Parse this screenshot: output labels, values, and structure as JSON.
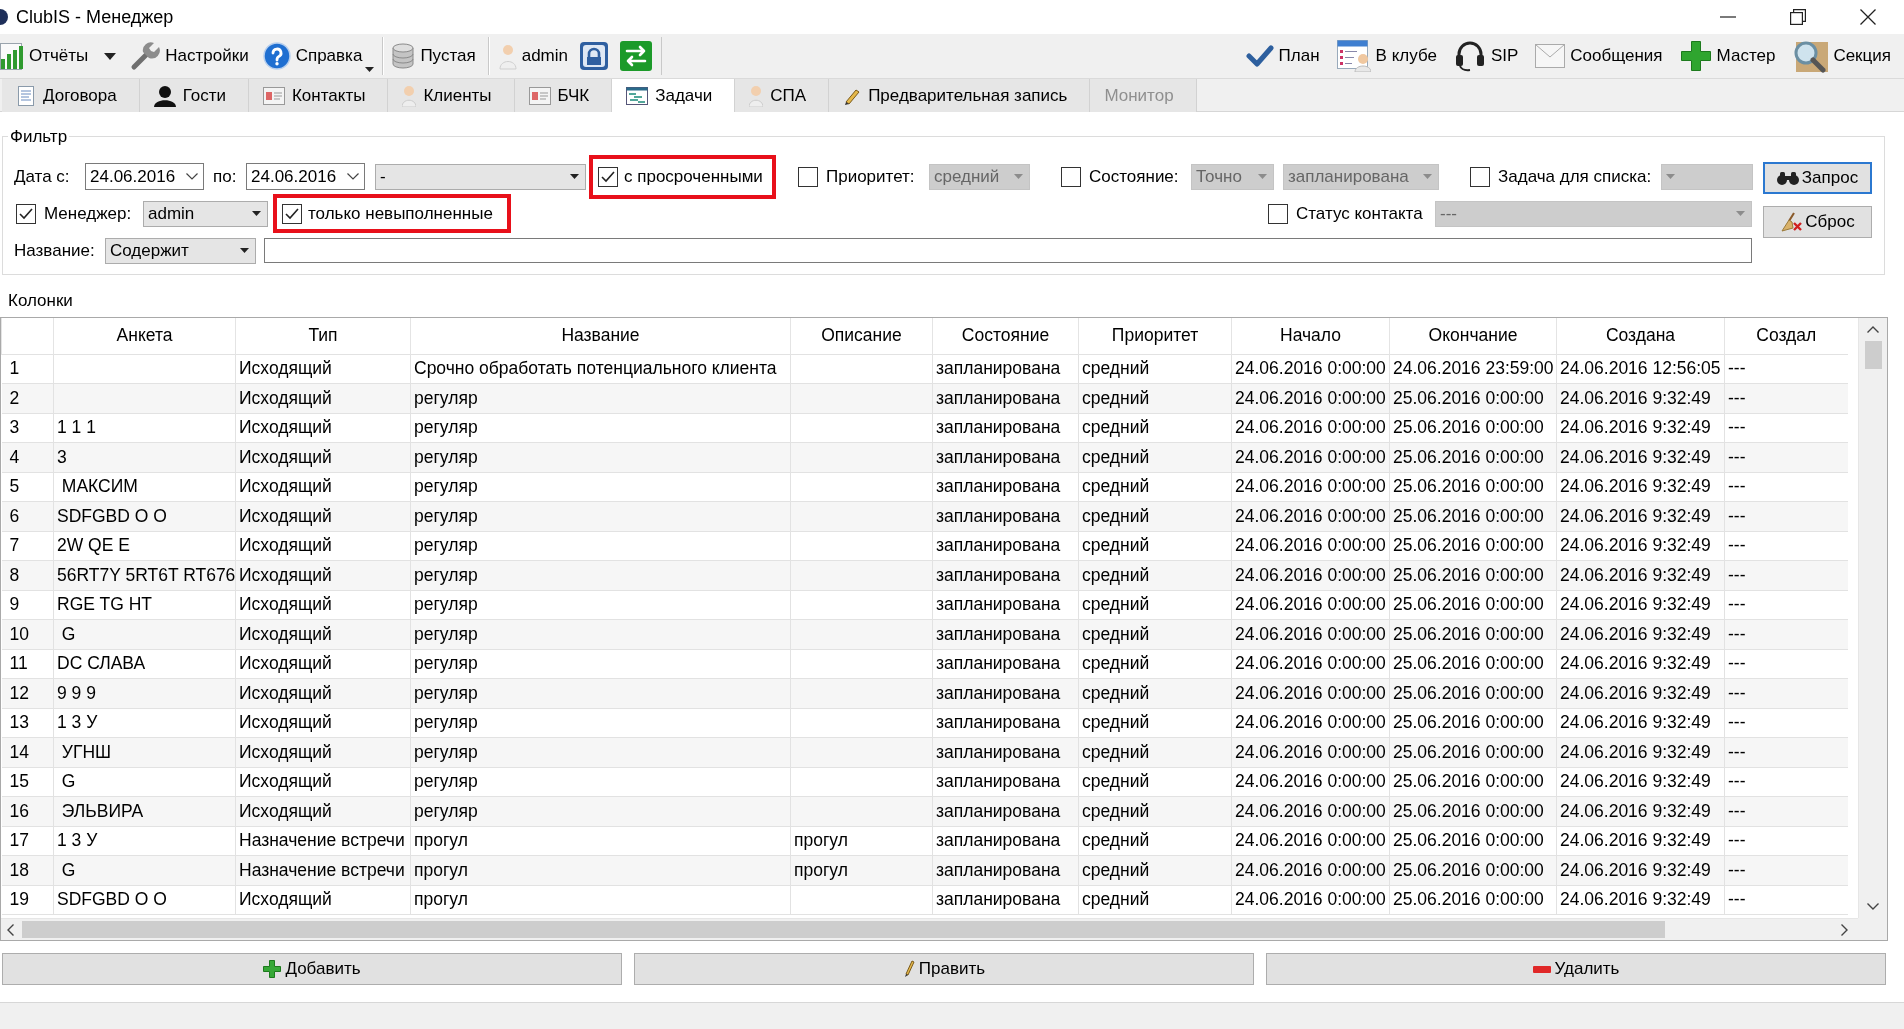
{
  "window": {
    "title": "ClubIS - Менеджер"
  },
  "toolbar": {
    "groups": [
      [
        {
          "kind": "split",
          "label": "Отчёты"
        },
        {
          "kind": "button",
          "label": "Настройки"
        },
        {
          "kind": "menu",
          "label": "Справка"
        }
      ],
      [
        {
          "kind": "button",
          "label": "Пустая"
        }
      ],
      [
        {
          "kind": "button",
          "label": "admin"
        },
        {
          "kind": "icon"
        },
        {
          "kind": "icon"
        }
      ]
    ],
    "right": [
      {
        "kind": "button",
        "label": "План"
      },
      {
        "kind": "button",
        "label": "В клубе"
      },
      {
        "kind": "button",
        "label": "SIP"
      },
      {
        "kind": "button",
        "label": "Сообщения"
      },
      {
        "kind": "button",
        "label": "Мастер"
      },
      {
        "kind": "button",
        "label": "Секция"
      }
    ]
  },
  "tabs": [
    {
      "label": "Договора",
      "selected": false,
      "disabled": false
    },
    {
      "label": "Гости",
      "selected": false,
      "disabled": false
    },
    {
      "label": "Контакты",
      "selected": false,
      "disabled": false
    },
    {
      "label": "Клиенты",
      "selected": false,
      "disabled": false
    },
    {
      "label": "БЧК",
      "selected": false,
      "disabled": false
    },
    {
      "label": "Задачи",
      "selected": true,
      "disabled": false
    },
    {
      "label": "СПА",
      "selected": false,
      "disabled": false
    },
    {
      "label": "Предварительная запись",
      "selected": false,
      "disabled": false
    },
    {
      "label": "Монитор",
      "selected": false,
      "disabled": true
    }
  ],
  "filter": {
    "title": "Фильтр",
    "date_from": {
      "label": "Дата с:",
      "value": "24.06.2016"
    },
    "date_to": {
      "label": "по:",
      "value": "24.06.2016"
    },
    "period": {
      "value": "-"
    },
    "overdue": {
      "label": "с просроченными",
      "checked": true,
      "highlighted": true
    },
    "priority": {
      "label": "Приоритет:",
      "checked": false,
      "value": "средний"
    },
    "state": {
      "label": "Состояние:",
      "checked": false,
      "match": "Точно",
      "value": "запланирована"
    },
    "task_list": {
      "label": "Задача для списка:",
      "checked": false
    },
    "manager": {
      "label": "Менеджер:",
      "checked": true,
      "value": "admin"
    },
    "unfinished": {
      "label": "только невыполненные",
      "checked": true,
      "highlighted": true
    },
    "contact_status": {
      "label": "Статус контакта",
      "checked": false,
      "value": "---"
    },
    "name": {
      "label": "Название:",
      "mode": "Содержит"
    },
    "buttons": [
      {
        "label": "Запрос",
        "default": true
      },
      {
        "label": "Сброс",
        "default": false
      }
    ]
  },
  "table": {
    "caption": "Колонки",
    "columns": [
      "Анкета",
      "Тип",
      "Название",
      "Описание",
      "Состояние",
      "Приоритет",
      "Начало",
      "Окончание",
      "Создана",
      "Создал"
    ],
    "rows": [
      {
        "number": "1",
        "type": "Исходящий",
        "name": "Срочно обработать потенциального клиента",
        "state": "запланирована",
        "priority": "средний",
        "start": "24.06.2016 0:00:00",
        "end": "24.06.2016 23:59:00",
        "created": "24.06.2016 12:56:05",
        "author": "---"
      },
      {
        "number": "2",
        "type": "Исходящий",
        "name": "регуляр",
        "state": "запланирована",
        "priority": "средний",
        "start": "24.06.2016 0:00:00",
        "end": "25.06.2016 0:00:00",
        "created": "24.06.2016 9:32:49",
        "author": "---"
      },
      {
        "number": "3",
        "anketa": "1 1 1",
        "type": "Исходящий",
        "name": "регуляр",
        "state": "запланирована",
        "priority": "средний",
        "start": "24.06.2016 0:00:00",
        "end": "25.06.2016 0:00:00",
        "created": "24.06.2016 9:32:49",
        "author": "---"
      },
      {
        "number": "4",
        "anketa": "3",
        "type": "Исходящий",
        "name": "регуляр",
        "state": "запланирована",
        "priority": "средний",
        "start": "24.06.2016 0:00:00",
        "end": "25.06.2016 0:00:00",
        "created": "24.06.2016 9:32:49",
        "author": "---"
      },
      {
        "number": "5",
        "anketa": " МАКСИМ",
        "type": "Исходящий",
        "name": "регуляр",
        "state": "запланирована",
        "priority": "средний",
        "start": "24.06.2016 0:00:00",
        "end": "25.06.2016 0:00:00",
        "created": "24.06.2016 9:32:49",
        "author": "---"
      },
      {
        "number": "6",
        "anketa": "SDFGBD O O",
        "type": "Исходящий",
        "name": "регуляр",
        "state": "запланирована",
        "priority": "средний",
        "start": "24.06.2016 0:00:00",
        "end": "25.06.2016 0:00:00",
        "created": "24.06.2016 9:32:49",
        "author": "---"
      },
      {
        "number": "7",
        "anketa": "2W QE E",
        "type": "Исходящий",
        "name": "регуляр",
        "state": "запланирована",
        "priority": "средний",
        "start": "24.06.2016 0:00:00",
        "end": "25.06.2016 0:00:00",
        "created": "24.06.2016 9:32:49",
        "author": "---"
      },
      {
        "number": "8",
        "anketa": "56RT7Y 5RT6T RT676",
        "type": "Исходящий",
        "name": "регуляр",
        "state": "запланирована",
        "priority": "средний",
        "start": "24.06.2016 0:00:00",
        "end": "25.06.2016 0:00:00",
        "created": "24.06.2016 9:32:49",
        "author": "---"
      },
      {
        "number": "9",
        "anketa": "RGE TG HT",
        "type": "Исходящий",
        "name": "регуляр",
        "state": "запланирована",
        "priority": "средний",
        "start": "24.06.2016 0:00:00",
        "end": "25.06.2016 0:00:00",
        "created": "24.06.2016 9:32:49",
        "author": "---"
      },
      {
        "number": "10",
        "anketa": " G",
        "type": "Исходящий",
        "name": "регуляр",
        "state": "запланирована",
        "priority": "средний",
        "start": "24.06.2016 0:00:00",
        "end": "25.06.2016 0:00:00",
        "created": "24.06.2016 9:32:49",
        "author": "---"
      },
      {
        "number": "11",
        "anketa": "DC СЛАВА",
        "type": "Исходящий",
        "name": "регуляр",
        "state": "запланирована",
        "priority": "средний",
        "start": "24.06.2016 0:00:00",
        "end": "25.06.2016 0:00:00",
        "created": "24.06.2016 9:32:49",
        "author": "---"
      },
      {
        "number": "12",
        "anketa": "9 9 9",
        "type": "Исходящий",
        "name": "регуляр",
        "state": "запланирована",
        "priority": "средний",
        "start": "24.06.2016 0:00:00",
        "end": "25.06.2016 0:00:00",
        "created": "24.06.2016 9:32:49",
        "author": "---"
      },
      {
        "number": "13",
        "anketa": "1 3 У",
        "type": "Исходящий",
        "name": "регуляр",
        "state": "запланирована",
        "priority": "средний",
        "start": "24.06.2016 0:00:00",
        "end": "25.06.2016 0:00:00",
        "created": "24.06.2016 9:32:49",
        "author": "---"
      },
      {
        "number": "14",
        "anketa": " УГНШ",
        "type": "Исходящий",
        "name": "регуляр",
        "state": "запланирована",
        "priority": "средний",
        "start": "24.06.2016 0:00:00",
        "end": "25.06.2016 0:00:00",
        "created": "24.06.2016 9:32:49",
        "author": "---"
      },
      {
        "number": "15",
        "anketa": " G",
        "type": "Исходящий",
        "name": "регуляр",
        "state": "запланирована",
        "priority": "средний",
        "start": "24.06.2016 0:00:00",
        "end": "25.06.2016 0:00:00",
        "created": "24.06.2016 9:32:49",
        "author": "---"
      },
      {
        "number": "16",
        "anketa": " ЭЛЬВИРА",
        "type": "Исходящий",
        "name": "регуляр",
        "state": "запланирована",
        "priority": "средний",
        "start": "24.06.2016 0:00:00",
        "end": "25.06.2016 0:00:00",
        "created": "24.06.2016 9:32:49",
        "author": "---"
      },
      {
        "number": "17",
        "anketa": "1 3 У",
        "type": "Назначение встречи",
        "name": "прогул",
        "description": "прогул",
        "state": "запланирована",
        "priority": "средний",
        "start": "24.06.2016 0:00:00",
        "end": "25.06.2016 0:00:00",
        "created": "24.06.2016 9:32:49",
        "author": "---"
      },
      {
        "number": "18",
        "anketa": " G",
        "type": "Назначение встречи",
        "name": "прогул",
        "description": "прогул",
        "state": "запланирована",
        "priority": "средний",
        "start": "24.06.2016 0:00:00",
        "end": "25.06.2016 0:00:00",
        "created": "24.06.2016 9:32:49",
        "author": "---"
      },
      {
        "number": "19",
        "anketa": "SDFGBD O O",
        "type": "Исходящий",
        "name": "прогул",
        "state": "запланирована",
        "priority": "средний",
        "start": "24.06.2016 0:00:00",
        "end": "25.06.2016 0:00:00",
        "created": "24.06.2016 9:32:49",
        "author": "---"
      }
    ]
  },
  "actions": [
    {
      "label": "Добавить"
    },
    {
      "label": "Править"
    },
    {
      "label": "Удалить"
    }
  ]
}
